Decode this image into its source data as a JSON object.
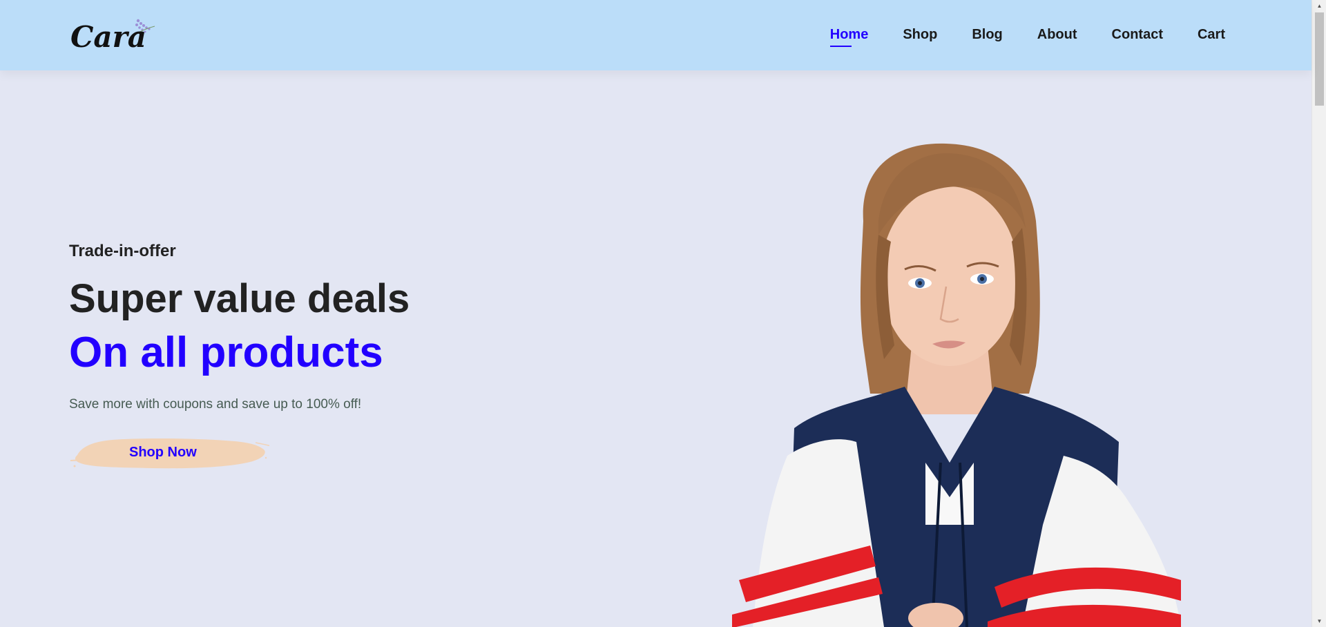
{
  "brand": {
    "logo_text": "Cara"
  },
  "nav": {
    "items": [
      {
        "label": "Home",
        "active": true
      },
      {
        "label": "Shop",
        "active": false
      },
      {
        "label": "Blog",
        "active": false
      },
      {
        "label": "About",
        "active": false
      },
      {
        "label": "Contact",
        "active": false
      },
      {
        "label": "Cart",
        "active": false
      }
    ]
  },
  "hero": {
    "eyebrow": "Trade-in-offer",
    "headline": "Super value deals",
    "headline_accent": "On all products",
    "subtext": "Save more with coupons and save up to 100% off!",
    "cta_label": "Shop Now"
  },
  "colors": {
    "header_bg": "#bbddf9",
    "page_bg": "#e3e6f3",
    "accent": "#2200ff",
    "button_brush": "#f2d3b6"
  }
}
